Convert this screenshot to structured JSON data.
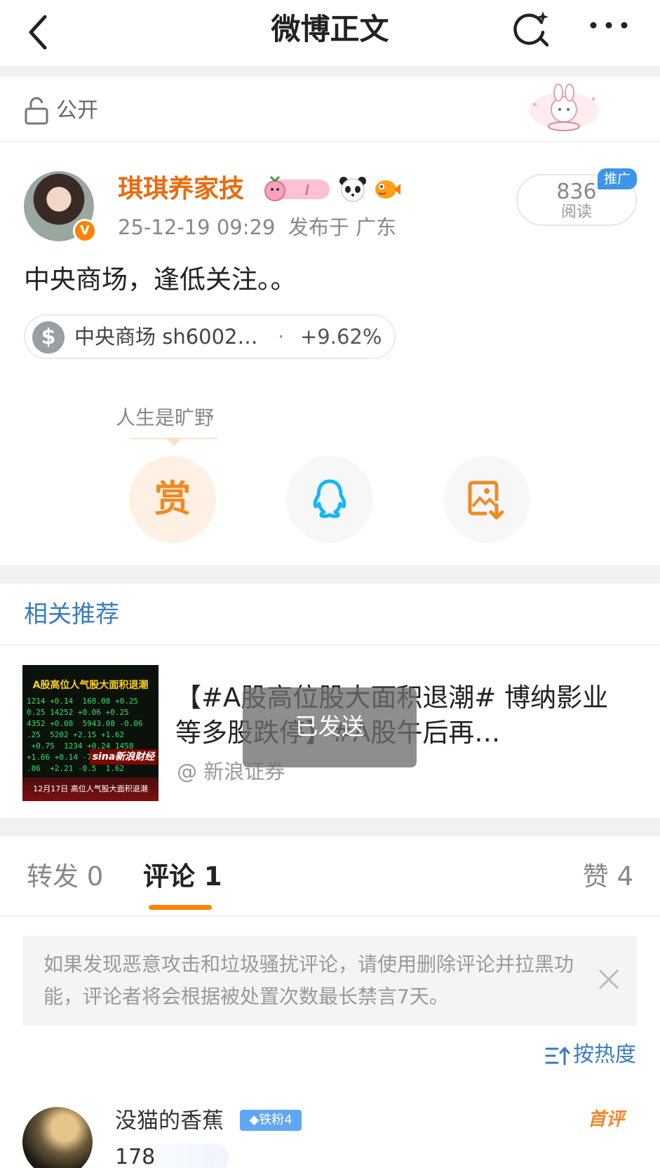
{
  "nav": {
    "title": "微博正文"
  },
  "visibility": {
    "label": "公开"
  },
  "post": {
    "author": "琪琪养家技",
    "verified_badge": "V",
    "time": "25-12-19 09:29",
    "location": "发布于 广东",
    "read_count": "836",
    "read_label": "阅读",
    "promo_tag": "推广",
    "text": "中央商场，逢低关注。。",
    "stock": {
      "name": "中央商场 sh6002…",
      "separator": "·",
      "change": "+9.62%"
    },
    "tip": "人生是旷野",
    "actions": {
      "reward_label": "赏"
    }
  },
  "related": {
    "title": "相关推荐",
    "item": {
      "text": "【#A股高位股大面积退潮# 博纳影业等多股跌停】#A股午后再…",
      "source": "@ 新浪证券",
      "thumb_title": "A股高位人气股大面积退潮",
      "thumb_brand": "sina新浪财经",
      "thumb_footer": "12月17日 高位人气股大面积退潮"
    }
  },
  "toast": {
    "text": "已发送"
  },
  "tabs": {
    "repost": "转发 0",
    "comment": "评论 1",
    "like": "赞 4"
  },
  "notice": {
    "text": "如果发现恶意攻击和垃圾骚扰评论，请使用删除评论并拉黑功能，评论者将会根据被处置次数最长禁言7天。"
  },
  "sort": {
    "label": "按热度"
  },
  "comment": {
    "name": "没猫的香蕉",
    "fan_badge": "铁粉4",
    "first_tag": "首评",
    "count": "178"
  },
  "colors": {
    "accent": "#ff8200",
    "link": "#3a7bbf",
    "author": "#e86b0c"
  },
  "icons": [
    "back-icon",
    "search-icon",
    "more-icon",
    "lock-icon",
    "dollar-icon",
    "qq-icon",
    "save-image-icon",
    "close-icon",
    "sort-icon"
  ]
}
